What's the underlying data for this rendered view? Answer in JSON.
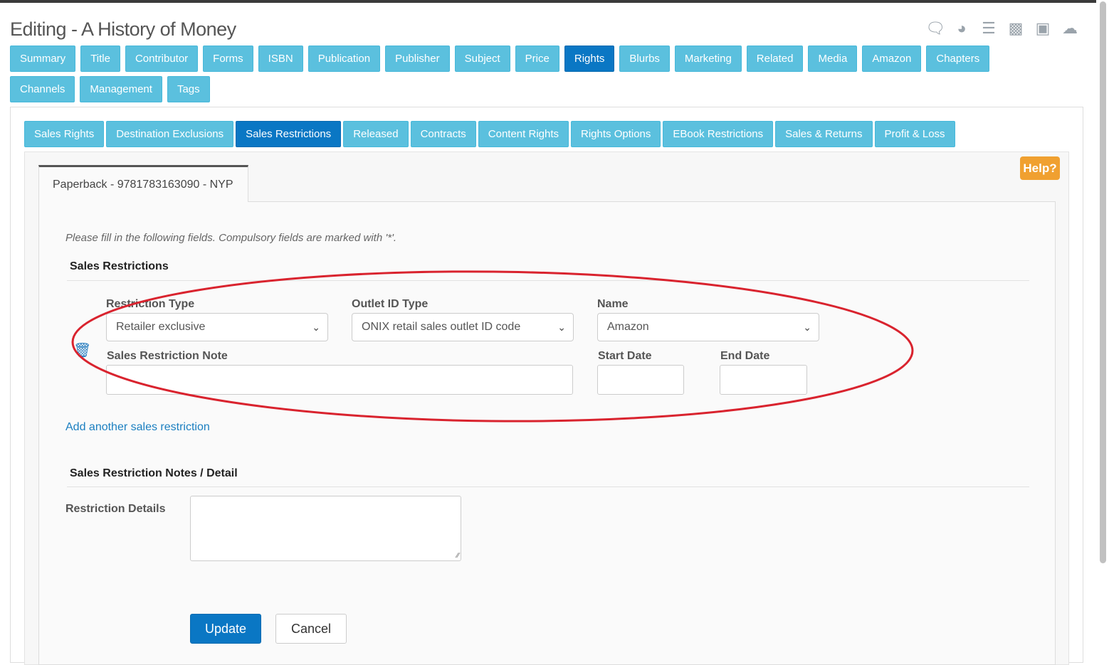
{
  "page": {
    "title": "Editing - A History of Money"
  },
  "toolbar_icons": [
    "comments-icon",
    "dashboard-icon",
    "list-icon",
    "archive-icon",
    "image-icon",
    "cloud-download-icon"
  ],
  "main_tabs": [
    {
      "label": "Summary"
    },
    {
      "label": "Title"
    },
    {
      "label": "Contributor"
    },
    {
      "label": "Forms"
    },
    {
      "label": "ISBN"
    },
    {
      "label": "Publication"
    },
    {
      "label": "Publisher"
    },
    {
      "label": "Subject"
    },
    {
      "label": "Price"
    },
    {
      "label": "Rights",
      "active": true
    },
    {
      "label": "Blurbs"
    },
    {
      "label": "Marketing"
    },
    {
      "label": "Related"
    },
    {
      "label": "Media"
    },
    {
      "label": "Amazon"
    },
    {
      "label": "Chapters"
    },
    {
      "label": "Channels"
    },
    {
      "label": "Management"
    },
    {
      "label": "Tags"
    }
  ],
  "sub_tabs": [
    {
      "label": "Sales Rights"
    },
    {
      "label": "Destination Exclusions"
    },
    {
      "label": "Sales Restrictions",
      "active": true
    },
    {
      "label": "Released"
    },
    {
      "label": "Contracts"
    },
    {
      "label": "Content Rights"
    },
    {
      "label": "Rights Options"
    },
    {
      "label": "EBook Restrictions"
    },
    {
      "label": "Sales & Returns"
    },
    {
      "label": "Profit & Loss"
    }
  ],
  "help": {
    "label": "Help?"
  },
  "format_tab": {
    "label": "Paperback - 9781783163090 - NYP"
  },
  "form": {
    "instructions": "Please fill in the following fields. Compulsory fields are marked with '*'.",
    "section_title": "Sales Restrictions",
    "restriction_type": {
      "label": "Restriction Type",
      "value": "Retailer exclusive"
    },
    "outlet_id_type": {
      "label": "Outlet ID Type",
      "value": "ONIX retail sales outlet ID code"
    },
    "name": {
      "label": "Name",
      "value": "Amazon"
    },
    "note": {
      "label": "Sales Restriction Note",
      "value": ""
    },
    "start_date": {
      "label": "Start Date",
      "value": ""
    },
    "end_date": {
      "label": "End Date",
      "value": ""
    },
    "add_link": "Add another sales restriction",
    "notes_section_title": "Sales Restriction Notes / Detail",
    "restriction_details": {
      "label": "Restriction Details",
      "value": ""
    },
    "update_label": "Update",
    "cancel_label": "Cancel"
  },
  "colors": {
    "tab": "#5bc0de",
    "tab_active": "#0a77c4",
    "help": "#f0a030",
    "annotation": "#d9232e"
  }
}
